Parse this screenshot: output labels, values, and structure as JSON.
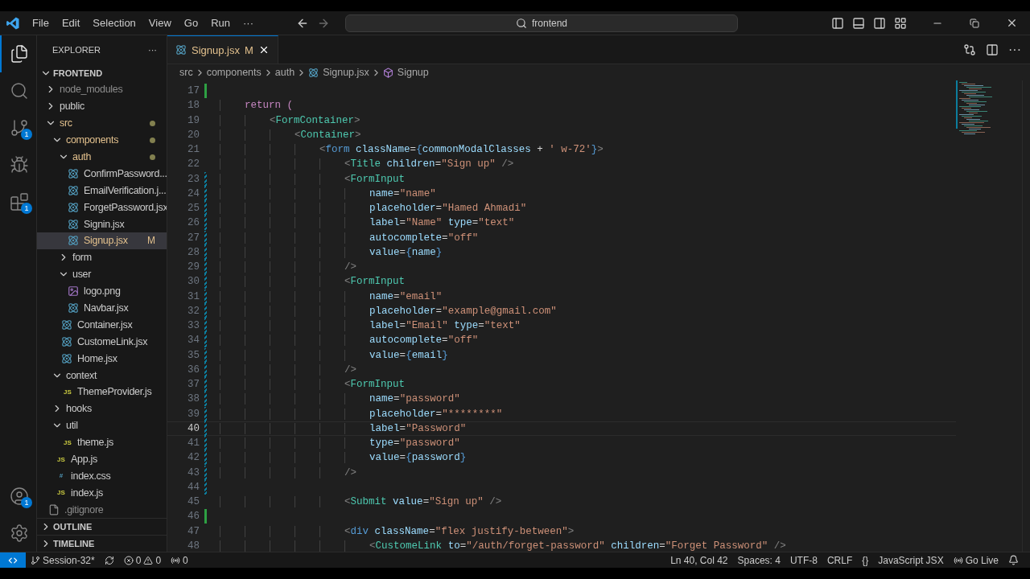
{
  "title_bar": {
    "menu": [
      "File",
      "Edit",
      "Selection",
      "View",
      "Go",
      "Run"
    ],
    "more": "···",
    "search": {
      "value": "frontend"
    }
  },
  "activity_bar": {
    "top": [
      {
        "kind": "explorer",
        "selected": true
      },
      {
        "kind": "search",
        "selected": false
      },
      {
        "kind": "source-control",
        "selected": false,
        "badge": "1"
      },
      {
        "kind": "run-debug",
        "selected": false
      },
      {
        "kind": "extensions",
        "selected": false,
        "badge": "1"
      }
    ],
    "bottom": [
      {
        "kind": "accounts",
        "selected": false,
        "badge": "1"
      },
      {
        "kind": "settings",
        "selected": false
      }
    ]
  },
  "sidebar": {
    "title": "EXPLORER",
    "more": "···",
    "root": {
      "label": "FRONTEND",
      "expanded": true
    },
    "tree": [
      {
        "label": "node_modules",
        "kind": "folder",
        "expanded": false,
        "selected": false,
        "modified": false,
        "ignored": true
      },
      {
        "label": "public",
        "kind": "folder",
        "expanded": false,
        "selected": false,
        "modified": false
      },
      {
        "label": "src",
        "kind": "folder",
        "expanded": true,
        "selected": false,
        "modified": true,
        "children": [
          {
            "label": "components",
            "kind": "folder",
            "expanded": true,
            "selected": false,
            "modified": true,
            "children": [
              {
                "label": "auth",
                "kind": "folder",
                "expanded": true,
                "selected": false,
                "modified": true,
                "children": [
                  {
                    "label": "ConfirmPassword...",
                    "kind": "react",
                    "selected": false,
                    "modified": false
                  },
                  {
                    "label": "EmailVerification.j...",
                    "kind": "react",
                    "selected": false,
                    "modified": false
                  },
                  {
                    "label": "ForgetPassword.jsx",
                    "kind": "react",
                    "selected": false,
                    "modified": false
                  },
                  {
                    "label": "Signin.jsx",
                    "kind": "react",
                    "selected": false,
                    "modified": false
                  },
                  {
                    "label": "Signup.jsx",
                    "kind": "react",
                    "selected": true,
                    "modified": true,
                    "status": "M"
                  }
                ]
              },
              {
                "label": "form",
                "kind": "folder",
                "expanded": false,
                "selected": false,
                "modified": false
              },
              {
                "label": "user",
                "kind": "folder",
                "expanded": true,
                "selected": false,
                "modified": false,
                "children": [
                  {
                    "label": "logo.png",
                    "kind": "image",
                    "selected": false,
                    "modified": false
                  },
                  {
                    "label": "Navbar.jsx",
                    "kind": "react",
                    "selected": false,
                    "modified": false
                  }
                ]
              },
              {
                "label": "Container.jsx",
                "kind": "react",
                "selected": false,
                "modified": false
              },
              {
                "label": "CustomeLink.jsx",
                "kind": "react",
                "selected": false,
                "modified": false
              },
              {
                "label": "Home.jsx",
                "kind": "react",
                "selected": false,
                "modified": false
              }
            ]
          },
          {
            "label": "context",
            "kind": "folder",
            "expanded": true,
            "selected": false,
            "modified": false,
            "children": [
              {
                "label": "ThemeProvider.js",
                "kind": "js",
                "selected": false,
                "modified": false,
                "badge": "JS"
              }
            ]
          },
          {
            "label": "hooks",
            "kind": "folder",
            "expanded": false,
            "selected": false,
            "modified": false
          },
          {
            "label": "util",
            "kind": "folder",
            "expanded": true,
            "selected": false,
            "modified": false,
            "children": [
              {
                "label": "theme.js",
                "kind": "js",
                "selected": false,
                "modified": false,
                "badge": "JS"
              }
            ]
          },
          {
            "label": "App.js",
            "kind": "js",
            "selected": false,
            "modified": false,
            "badge": "JS"
          },
          {
            "label": "index.css",
            "kind": "css",
            "selected": false,
            "modified": false,
            "badge": "#"
          },
          {
            "label": "index.js",
            "kind": "js",
            "selected": false,
            "modified": false,
            "badge": "JS"
          }
        ]
      },
      {
        "label": ".gitignore",
        "kind": "file",
        "selected": false,
        "modified": false,
        "ignored": true
      }
    ],
    "sections": [
      {
        "label": "OUTLINE",
        "expanded": false
      },
      {
        "label": "TIMELINE",
        "expanded": false
      }
    ]
  },
  "tabs": [
    {
      "label": "Signup.jsx",
      "status": "M",
      "selected": true
    }
  ],
  "breadcrumb": [
    {
      "kind": "folder",
      "text": "src"
    },
    {
      "kind": "folder",
      "text": "components"
    },
    {
      "kind": "folder",
      "text": "auth"
    },
    {
      "kind": "react",
      "text": "Signup.jsx"
    },
    {
      "kind": "component",
      "text": "Signup"
    }
  ],
  "editor": {
    "lines": [
      {
        "number": "17",
        "current": false,
        "added": true,
        "modified": false
      },
      {
        "number": "18",
        "current": false,
        "added": false,
        "modified": false,
        "tokens": [
          {
            "kind": "keyword",
            "text": "    return ("
          }
        ]
      },
      {
        "number": "19",
        "current": false,
        "added": false,
        "modified": false,
        "tokens": [
          {
            "kind": "punct",
            "text": "        <"
          },
          {
            "kind": "tag",
            "text": "FormContainer"
          },
          {
            "kind": "punct",
            "text": ">"
          }
        ]
      },
      {
        "number": "20",
        "current": false,
        "added": false,
        "modified": false,
        "tokens": [
          {
            "kind": "punct",
            "text": "            <"
          },
          {
            "kind": "tag",
            "text": "Container"
          },
          {
            "kind": "punct",
            "text": ">"
          }
        ]
      },
      {
        "number": "21",
        "current": false,
        "added": false,
        "modified": false,
        "tokens": [
          {
            "kind": "punct",
            "text": "                <"
          },
          {
            "kind": "html",
            "text": "form"
          },
          {
            "kind": "attr",
            "text": " className"
          },
          {
            "kind": "plain",
            "text": "="
          },
          {
            "kind": "brace",
            "text": "{"
          },
          {
            "kind": "var",
            "text": "commonModalClasses"
          },
          {
            "kind": "plain",
            "text": " + "
          },
          {
            "kind": "string",
            "text": "' w-72'"
          },
          {
            "kind": "brace",
            "text": "}"
          },
          {
            "kind": "punct",
            "text": ">"
          }
        ]
      },
      {
        "number": "22",
        "current": false,
        "added": false,
        "modified": false,
        "tokens": [
          {
            "kind": "punct",
            "text": "                    <"
          },
          {
            "kind": "tag",
            "text": "Title"
          },
          {
            "kind": "attr",
            "text": " children"
          },
          {
            "kind": "plain",
            "text": "="
          },
          {
            "kind": "string",
            "text": "\"Sign up\""
          },
          {
            "kind": "punct",
            "text": " />"
          }
        ]
      },
      {
        "number": "23",
        "current": false,
        "added": false,
        "modified": true,
        "tokens": [
          {
            "kind": "punct",
            "text": "                    <"
          },
          {
            "kind": "tag",
            "text": "FormInput"
          }
        ]
      },
      {
        "number": "24",
        "current": false,
        "added": false,
        "modified": true,
        "tokens": [
          {
            "kind": "attr",
            "text": "                        name"
          },
          {
            "kind": "plain",
            "text": "="
          },
          {
            "kind": "string",
            "text": "\"name\""
          }
        ]
      },
      {
        "number": "25",
        "current": false,
        "added": false,
        "modified": true,
        "tokens": [
          {
            "kind": "attr",
            "text": "                        placeholder"
          },
          {
            "kind": "plain",
            "text": "="
          },
          {
            "kind": "string",
            "text": "\"Hamed Ahmadi\""
          }
        ]
      },
      {
        "number": "26",
        "current": false,
        "added": false,
        "modified": true,
        "tokens": [
          {
            "kind": "attr",
            "text": "                        label"
          },
          {
            "kind": "plain",
            "text": "="
          },
          {
            "kind": "string",
            "text": "\"Name\""
          },
          {
            "kind": "attr",
            "text": " type"
          },
          {
            "kind": "plain",
            "text": "="
          },
          {
            "kind": "string",
            "text": "\"text\""
          }
        ]
      },
      {
        "number": "27",
        "current": false,
        "added": false,
        "modified": true,
        "tokens": [
          {
            "kind": "attr",
            "text": "                        autocomplete"
          },
          {
            "kind": "plain",
            "text": "="
          },
          {
            "kind": "string",
            "text": "\"off\""
          }
        ]
      },
      {
        "number": "28",
        "current": false,
        "added": false,
        "modified": true,
        "tokens": [
          {
            "kind": "attr",
            "text": "                        value"
          },
          {
            "kind": "plain",
            "text": "="
          },
          {
            "kind": "brace",
            "text": "{"
          },
          {
            "kind": "var",
            "text": "name"
          },
          {
            "kind": "brace",
            "text": "}"
          }
        ]
      },
      {
        "number": "29",
        "current": false,
        "added": false,
        "modified": true,
        "tokens": [
          {
            "kind": "punct",
            "text": "                    />"
          }
        ]
      },
      {
        "number": "30",
        "current": false,
        "added": false,
        "modified": true,
        "tokens": [
          {
            "kind": "punct",
            "text": "                    <"
          },
          {
            "kind": "tag",
            "text": "FormInput"
          }
        ]
      },
      {
        "number": "31",
        "current": false,
        "added": false,
        "modified": true,
        "tokens": [
          {
            "kind": "attr",
            "text": "                        name"
          },
          {
            "kind": "plain",
            "text": "="
          },
          {
            "kind": "string",
            "text": "\"email\""
          }
        ]
      },
      {
        "number": "32",
        "current": false,
        "added": false,
        "modified": true,
        "tokens": [
          {
            "kind": "attr",
            "text": "                        placeholder"
          },
          {
            "kind": "plain",
            "text": "="
          },
          {
            "kind": "string",
            "text": "\"example@gmail.com\""
          }
        ]
      },
      {
        "number": "33",
        "current": false,
        "added": false,
        "modified": true,
        "tokens": [
          {
            "kind": "attr",
            "text": "                        label"
          },
          {
            "kind": "plain",
            "text": "="
          },
          {
            "kind": "string",
            "text": "\"Email\""
          },
          {
            "kind": "attr",
            "text": " type"
          },
          {
            "kind": "plain",
            "text": "="
          },
          {
            "kind": "string",
            "text": "\"text\""
          }
        ]
      },
      {
        "number": "34",
        "current": false,
        "added": false,
        "modified": true,
        "tokens": [
          {
            "kind": "attr",
            "text": "                        autocomplete"
          },
          {
            "kind": "plain",
            "text": "="
          },
          {
            "kind": "string",
            "text": "\"off\""
          }
        ]
      },
      {
        "number": "35",
        "current": false,
        "added": false,
        "modified": true,
        "tokens": [
          {
            "kind": "attr",
            "text": "                        value"
          },
          {
            "kind": "plain",
            "text": "="
          },
          {
            "kind": "brace",
            "text": "{"
          },
          {
            "kind": "var",
            "text": "email"
          },
          {
            "kind": "brace",
            "text": "}"
          }
        ]
      },
      {
        "number": "36",
        "current": false,
        "added": false,
        "modified": true,
        "tokens": [
          {
            "kind": "punct",
            "text": "                    />"
          }
        ]
      },
      {
        "number": "37",
        "current": false,
        "added": false,
        "modified": true,
        "tokens": [
          {
            "kind": "punct",
            "text": "                    <"
          },
          {
            "kind": "tag",
            "text": "FormInput"
          }
        ]
      },
      {
        "number": "38",
        "current": false,
        "added": false,
        "modified": true,
        "tokens": [
          {
            "kind": "attr",
            "text": "                        name"
          },
          {
            "kind": "plain",
            "text": "="
          },
          {
            "kind": "string",
            "text": "\"password\""
          }
        ]
      },
      {
        "number": "39",
        "current": false,
        "added": false,
        "modified": true,
        "tokens": [
          {
            "kind": "attr",
            "text": "                        placeholder"
          },
          {
            "kind": "plain",
            "text": "="
          },
          {
            "kind": "string",
            "text": "\"********\""
          }
        ]
      },
      {
        "number": "40",
        "current": true,
        "added": false,
        "modified": true,
        "tokens": [
          {
            "kind": "attr",
            "text": "                        label"
          },
          {
            "kind": "plain",
            "text": "="
          },
          {
            "kind": "string",
            "text": "\"Password\""
          }
        ]
      },
      {
        "number": "41",
        "current": false,
        "added": false,
        "modified": true,
        "tokens": [
          {
            "kind": "attr",
            "text": "                        type"
          },
          {
            "kind": "plain",
            "text": "="
          },
          {
            "kind": "string",
            "text": "\"password\""
          }
        ]
      },
      {
        "number": "42",
        "current": false,
        "added": false,
        "modified": true,
        "tokens": [
          {
            "kind": "attr",
            "text": "                        value"
          },
          {
            "kind": "plain",
            "text": "="
          },
          {
            "kind": "brace",
            "text": "{"
          },
          {
            "kind": "var",
            "text": "password"
          },
          {
            "kind": "brace",
            "text": "}"
          }
        ]
      },
      {
        "number": "43",
        "current": false,
        "added": false,
        "modified": true,
        "tokens": [
          {
            "kind": "punct",
            "text": "                    />"
          }
        ]
      },
      {
        "number": "44",
        "current": false,
        "added": false,
        "modified": true
      },
      {
        "number": "45",
        "current": false,
        "added": false,
        "modified": false,
        "tokens": [
          {
            "kind": "punct",
            "text": "                    <"
          },
          {
            "kind": "tag",
            "text": "Submit"
          },
          {
            "kind": "attr",
            "text": " value"
          },
          {
            "kind": "plain",
            "text": "="
          },
          {
            "kind": "string",
            "text": "\"Sign up\""
          },
          {
            "kind": "punct",
            "text": " />"
          }
        ]
      },
      {
        "number": "46",
        "current": false,
        "added": true,
        "modified": false
      },
      {
        "number": "47",
        "current": false,
        "added": false,
        "modified": false,
        "tokens": [
          {
            "kind": "punct",
            "text": "                    <"
          },
          {
            "kind": "html",
            "text": "div"
          },
          {
            "kind": "attr",
            "text": " className"
          },
          {
            "kind": "plain",
            "text": "="
          },
          {
            "kind": "string",
            "text": "\"flex justify-between\""
          },
          {
            "kind": "punct",
            "text": ">"
          }
        ]
      },
      {
        "number": "48",
        "current": false,
        "added": false,
        "modified": false,
        "tokens": [
          {
            "kind": "punct",
            "text": "                        <"
          },
          {
            "kind": "tag",
            "text": "CustomeLink"
          },
          {
            "kind": "attr",
            "text": " to"
          },
          {
            "kind": "plain",
            "text": "="
          },
          {
            "kind": "string",
            "text": "\"/auth/forget-password\""
          },
          {
            "kind": "attr",
            "text": " children"
          },
          {
            "kind": "plain",
            "text": "="
          },
          {
            "kind": "string",
            "text": "\"Forget Password\""
          },
          {
            "kind": "punct",
            "text": " />"
          }
        ]
      }
    ]
  },
  "status_bar": {
    "branch": "Session-32*",
    "errors": "0",
    "warnings": "0",
    "ports": "0",
    "right": [
      {
        "kind": "text",
        "text": "Ln 40, Col 42"
      },
      {
        "kind": "text",
        "text": "Spaces: 4"
      },
      {
        "kind": "text",
        "text": "UTF-8"
      },
      {
        "kind": "text",
        "text": "CRLF"
      },
      {
        "kind": "language",
        "text": "JavaScript JSX",
        "glyph": "{}"
      },
      {
        "kind": "live",
        "text": "Go Live"
      },
      {
        "kind": "bell"
      }
    ]
  }
}
